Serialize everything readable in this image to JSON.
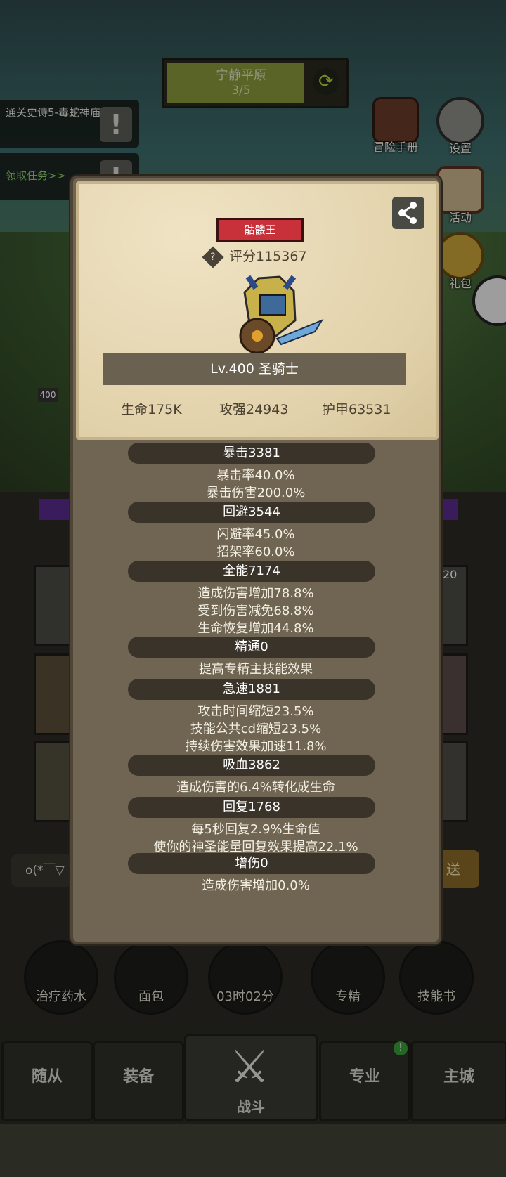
{
  "zone": {
    "name": "宁静平原",
    "progress": "3/5"
  },
  "quests": [
    {
      "text": "通关史诗5-毒蛇神庙"
    },
    {
      "text": "领取任务>>"
    }
  ],
  "right_menu": [
    {
      "label": "冒险手册",
      "icon": "book-icon"
    },
    {
      "label": "设置",
      "icon": "gear-icon"
    },
    {
      "label": "活动",
      "icon": "scroll-icon"
    },
    {
      "label": "礼包",
      "icon": "gift-icon"
    }
  ],
  "character": {
    "title_badge": "骷髅王",
    "score": "评分115367",
    "level_class": "Lv.400 圣骑士",
    "hp": "生命175K",
    "attack": "攻强24943",
    "armor": "护甲63531"
  },
  "stats": [
    {
      "header": "暴击3381",
      "lines": [
        "暴击率40.0%",
        "暴击伤害200.0%"
      ]
    },
    {
      "header": "回避3544",
      "lines": [
        "闪避率45.0%",
        "招架率60.0%"
      ]
    },
    {
      "header": "全能7174",
      "lines": [
        "造成伤害增加78.8%",
        "受到伤害减免68.8%",
        "生命恢复增加44.8%"
      ]
    },
    {
      "header": "精通0",
      "lines": [
        "提高专精主技能效果"
      ]
    },
    {
      "header": "急速1881",
      "lines": [
        "攻击时间缩短23.5%",
        "技能公共cd缩短23.5%",
        "持续伤害效果加速11.8%"
      ]
    },
    {
      "header": "吸血3862",
      "lines": [
        "造成伤害的6.4%转化成生命"
      ]
    },
    {
      "header": "回复1768",
      "lines": [
        "每5秒回复2.9%生命值",
        "使你的神圣能量回复效果提高22.1%"
      ]
    },
    {
      "header": "增伤0",
      "lines": [
        "造成伤害增加0.0%"
      ]
    }
  ],
  "bottom_items": [
    {
      "label": "治疗药水"
    },
    {
      "label": "面包"
    },
    {
      "label": "03时02分"
    },
    {
      "label": "专精"
    },
    {
      "label": "技能书"
    }
  ],
  "tabs": [
    {
      "label": "随从"
    },
    {
      "label": "装备"
    },
    {
      "label": "战斗"
    },
    {
      "label": "专业"
    },
    {
      "label": "主城"
    }
  ],
  "misc": {
    "player_level_tag": "400",
    "slot_count": "20",
    "chat_text": "o(*￣▽",
    "send_label": "送"
  }
}
